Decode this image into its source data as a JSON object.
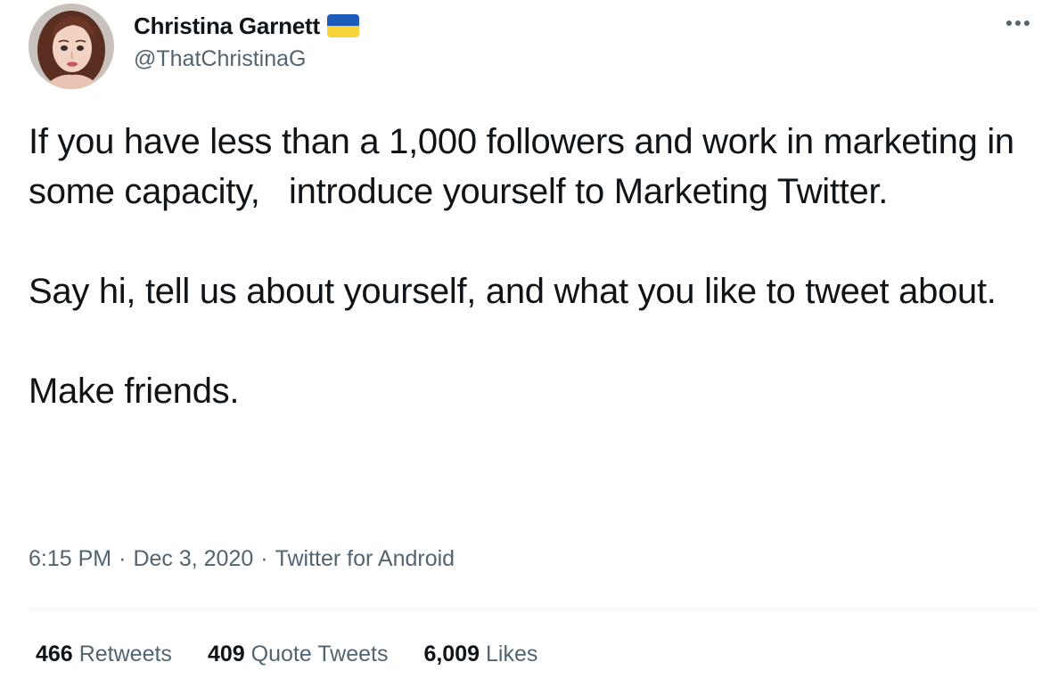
{
  "author": {
    "display_name": "Christina Garnett",
    "handle": "@ThatChristinaG",
    "avatar_icon": "profile-avatar",
    "flag_icon": "ukraine-flag-icon",
    "flag_colors": [
      "#1f5bb8",
      "#f8d33a"
    ]
  },
  "tweet": {
    "paragraphs": [
      "If you have less than a 1,000 followers and work in marketing in some capacity,   introduce yourself to Marketing Twitter.",
      "Say hi, tell us about yourself, and what you like to tweet about.",
      "Make friends."
    ],
    "time": "6:15 PM",
    "date": "Dec 3, 2020",
    "source": "Twitter for Android",
    "separator": "·"
  },
  "stats": {
    "retweets": {
      "count": "466",
      "label": "Retweets"
    },
    "quote_tweets": {
      "count": "409",
      "label": "Quote Tweets"
    },
    "likes": {
      "count": "6,009",
      "label": "Likes"
    }
  },
  "colors": {
    "text_primary": "#0f1419",
    "text_secondary": "#536471",
    "divider": "#eff3f4"
  },
  "more_icon": "more-options-icon"
}
